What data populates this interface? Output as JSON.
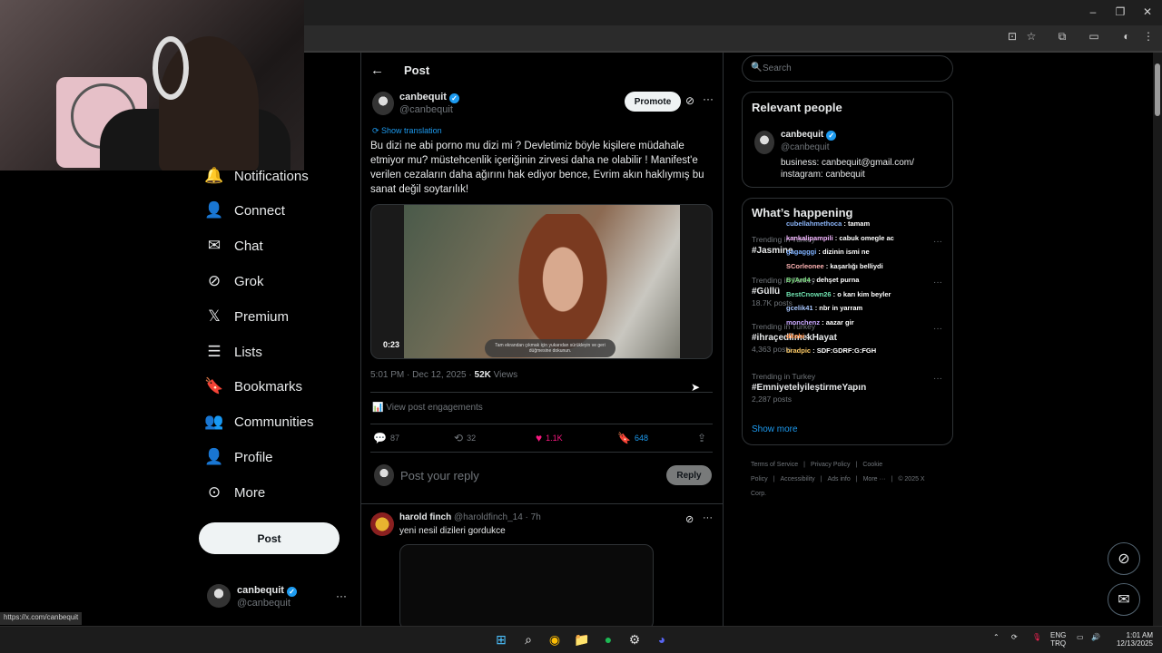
{
  "browser": {
    "status_url": "https://x.com/canbequit"
  },
  "nav": {
    "items": [
      {
        "label": "Notifications",
        "icon": "bell-icon",
        "glyph": "🔔"
      },
      {
        "label": "Connect",
        "icon": "person-add-icon",
        "glyph": "👤"
      },
      {
        "label": "Chat",
        "icon": "mail-icon",
        "glyph": "✉"
      },
      {
        "label": "Grok",
        "icon": "grok-icon",
        "glyph": "⊘"
      },
      {
        "label": "Premium",
        "icon": "x-logo-icon",
        "glyph": "𝕏"
      },
      {
        "label": "Lists",
        "icon": "list-icon",
        "glyph": "☰"
      },
      {
        "label": "Bookmarks",
        "icon": "bookmark-icon",
        "glyph": "🔖"
      },
      {
        "label": "Communities",
        "icon": "communities-icon",
        "glyph": "👥"
      },
      {
        "label": "Profile",
        "icon": "profile-icon",
        "glyph": "👤"
      },
      {
        "label": "More",
        "icon": "more-circle-icon",
        "glyph": "⊙"
      }
    ],
    "post_button": "Post",
    "account": {
      "name": "canbequit",
      "handle": "@canbequit",
      "more": "···"
    }
  },
  "post": {
    "header_title": "Post",
    "author_name": "canbequit",
    "author_handle": "@canbequit",
    "promote_label": "Promote",
    "show_translation": "Show translation",
    "text": "Bu dizi ne abi porno mu dizi mi ? Devletimiz böyle kişilere müdahale etmiyor mu? müstehcenlik içeriğinin zirvesi daha ne olabilir ! Manifest'e verilen cezaların daha ağırını hak ediyor bence, Evrim akın haklıymış bu sanat değil soytarılık!",
    "video_time": "0:23",
    "video_caption": "Tam ekrandan çıkmak için yukarıdan sürükleyin ve geri düğmesine dokunun.",
    "timestamp": "5:01 PM · Dec 12, 2025 · ",
    "views_count": "52K",
    "views_label": " Views",
    "engagements_label": "View post engagements",
    "replies": "87",
    "reposts": "32",
    "likes": "1.1K",
    "bookmarks": "648",
    "like_color": "#f91880",
    "bookmark_color": "#1d9bf0",
    "reply_placeholder": "Post your reply",
    "reply_button": "Reply"
  },
  "comment": {
    "name": "harold finch",
    "handle": "@haroldfinch_14 · 7h",
    "text": "yeni nesil dizileri gordukce"
  },
  "sidebar": {
    "search_placeholder": "Search",
    "relevant_title": "Relevant people",
    "relevant_name": "canbequit",
    "relevant_handle": "@canbequit",
    "relevant_bio_1": "business: canbequit@gmail.com/",
    "relevant_bio_2": "instagram: canbequit",
    "happening_title": "What’s happening",
    "trends": [
      {
        "context": "Trending in Turkey",
        "name": "#Jasmine",
        "count": ""
      },
      {
        "context": "Trending in Turkey",
        "name": "#Güllü",
        "count": "18.7K posts"
      },
      {
        "context": "Trending in Turkey",
        "name": "#ihraçedilmekHayat",
        "count": "4,363 posts"
      },
      {
        "context": "Trending in Turkey",
        "name": "#EmniyeteİyileştirmeYapın",
        "count": "2,287 posts"
      }
    ],
    "show_more": "Show more",
    "footer": [
      "Terms of Service",
      "|",
      "Privacy Policy",
      "|",
      "Cookie Policy",
      "|",
      "Accessibility",
      "|",
      "Ads info",
      "|",
      "More ···",
      "|",
      "© 2025 X Corp."
    ]
  },
  "chat_overlay": [
    {
      "user": "cubellahmethoca",
      "msg": " : tamam",
      "color": "#8ab4f8"
    },
    {
      "user": "kankalipampili",
      "msg": " : cabuk omegle ac",
      "color": "#f4b6ff"
    },
    {
      "user": "gagagggi",
      "msg": " : dizinin ismi ne",
      "color": "#7fb2ff"
    },
    {
      "user": "SCorleonee",
      "msg": " : kaşarlığı belliydi",
      "color": "#ffb3b3"
    },
    {
      "user": "ByArd4",
      "msg": " : dehşet purna",
      "color": "#7ee081"
    },
    {
      "user": "BestCnown26",
      "msg": " : o karı kim beyler",
      "color": "#6fe3b0"
    },
    {
      "user": "gcelik41",
      "msg": " : nbr in yarram",
      "color": "#a8c7ff"
    },
    {
      "user": "monchenz",
      "msg": " : aazar gir",
      "color": "#c9a8ff"
    },
    {
      "user": "dkobi",
      "msg": " : ",
      "color": "#ff8c42"
    },
    {
      "user": "bradpic",
      "msg": " : SDF:GDRF:G:FGH",
      "color": "#ffcc66"
    }
  ],
  "taskbar": {
    "lang_1": "ENG",
    "lang_2": "TRQ",
    "time": "1:01 AM",
    "date": "12/13/2025"
  }
}
